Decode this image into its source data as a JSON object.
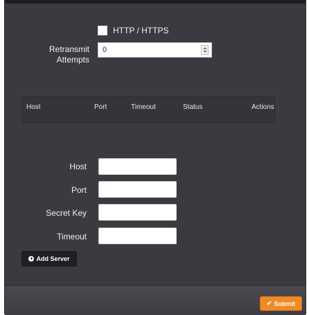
{
  "protocol": {
    "checkbox_label": "HTTP / HTTPS"
  },
  "retransmit": {
    "label_line1": "Retransmit",
    "label_line2": "Attempts",
    "value": "0"
  },
  "table": {
    "headers": [
      "Host",
      "Port",
      "Timeout",
      "Status",
      "Actions"
    ]
  },
  "form": {
    "host_label": "Host",
    "port_label": "Port",
    "secret_label": "Secret Key",
    "timeout_label": "Timeout"
  },
  "buttons": {
    "add_server": "Add Server",
    "submit": "Submit"
  },
  "colors": {
    "panel": "#3a3b41",
    "accent": "#f08a24"
  }
}
